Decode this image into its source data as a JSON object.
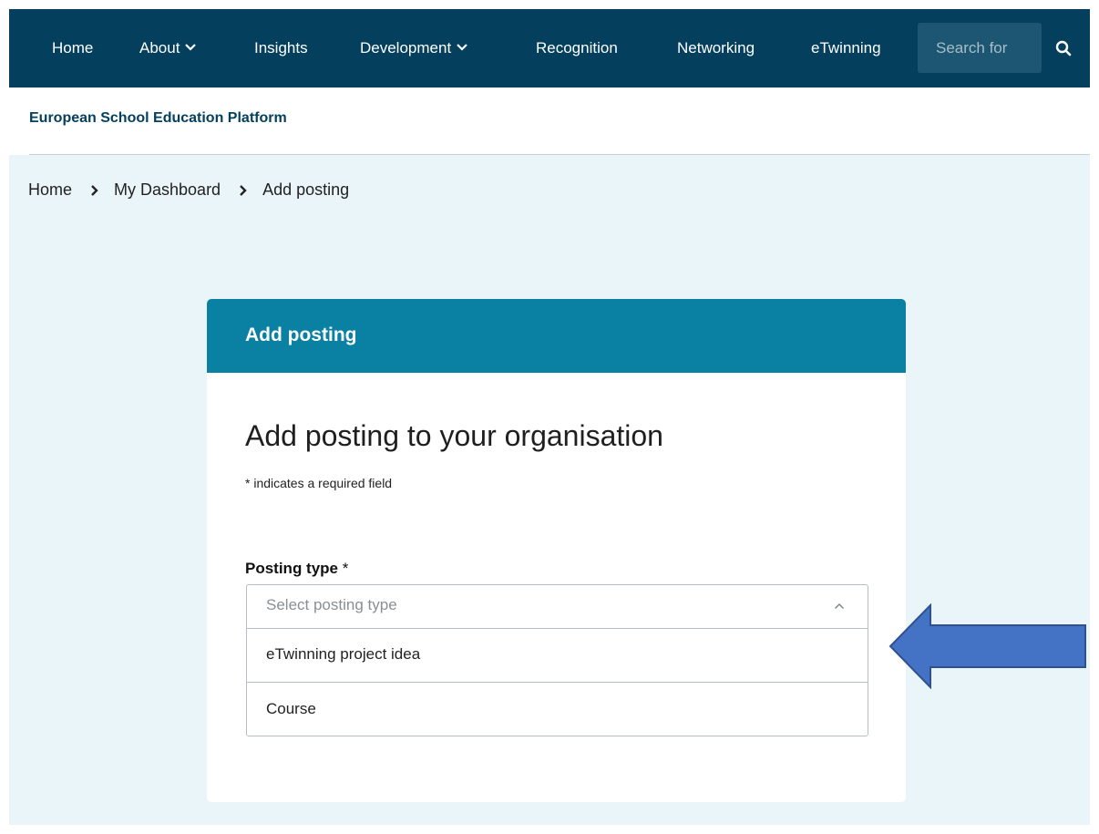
{
  "nav": {
    "items": [
      {
        "label": "Home",
        "dropdown": false
      },
      {
        "label": "About",
        "dropdown": true
      },
      {
        "label": "Insights",
        "dropdown": false
      },
      {
        "label": "Development",
        "dropdown": true
      },
      {
        "label": "Recognition",
        "dropdown": false
      },
      {
        "label": "Networking",
        "dropdown": false
      },
      {
        "label": "eTwinning",
        "dropdown": false
      }
    ],
    "search_placeholder": "Search for",
    "search_icon": "search-icon"
  },
  "platform": {
    "title": "European School Education Platform"
  },
  "breadcrumb": {
    "items": [
      "Home",
      "My Dashboard",
      "Add posting"
    ]
  },
  "card": {
    "header_title": "Add posting",
    "heading": "Add posting to your organisation",
    "required_note": "* indicates a required field",
    "field": {
      "label": "Posting type",
      "required_mark": "*",
      "placeholder": "Select posting type",
      "expanded": true,
      "options": [
        "eTwinning project idea",
        "Course"
      ]
    }
  },
  "colors": {
    "nav_bg": "#04405e",
    "search_bg": "#1c5672",
    "platform_title": "#04405e",
    "content_bg": "#eaf5fa",
    "card_header_bg": "#0a80a3",
    "annotation_arrow": "#4472c4"
  }
}
